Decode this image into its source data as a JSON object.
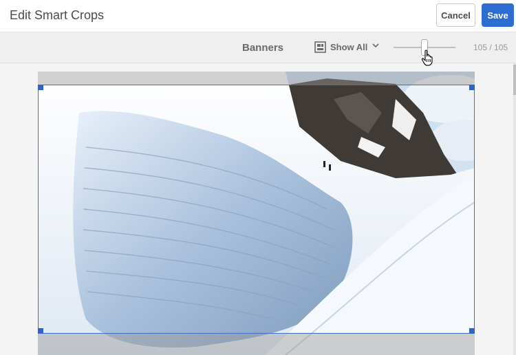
{
  "header": {
    "title": "Edit Smart Crops",
    "cancel_label": "Cancel",
    "save_label": "Save"
  },
  "toolbar": {
    "crop_name": "Banners",
    "show_all_label": "Show All",
    "slider_value_fraction": 0.5,
    "counter": "105 / 105"
  },
  "colors": {
    "accent": "#2d6dd2",
    "crop_border": "#3f6fc7"
  },
  "icons": {
    "show_all": "grid-view-icon",
    "dropdown": "chevron-down-icon",
    "cursor": "hand-pointer-icon"
  }
}
